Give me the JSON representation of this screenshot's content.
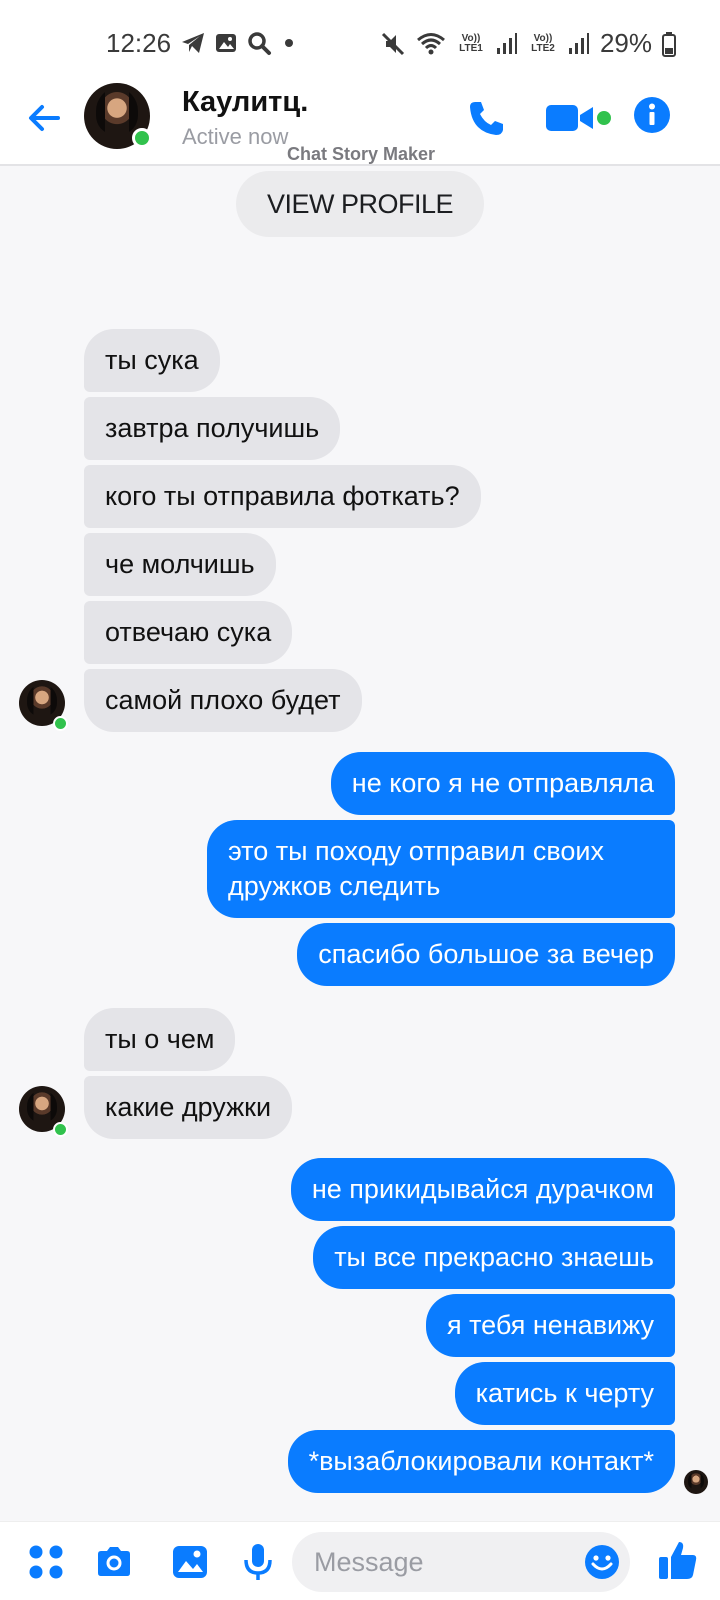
{
  "status_bar": {
    "time": "12:26",
    "battery": "29%",
    "sim1_label": "Vo)) LTE1",
    "sim2_label": "Vo)) LTE2",
    "left_icons": [
      "telegram-icon",
      "gallery-icon",
      "search-icon",
      "dot-icon"
    ],
    "right_icons": [
      "mute-icon",
      "wifi-icon",
      "signal-icon",
      "battery-icon"
    ]
  },
  "header": {
    "contact_name": "Каулитц.",
    "status": "Active now",
    "watermark": "Chat Story Maker",
    "accent_color": "#0a7cff"
  },
  "view_profile_label": "VIEW PROFILE",
  "messages": [
    {
      "from": "them",
      "text": "ты сука"
    },
    {
      "from": "them",
      "text": "завтра получишь"
    },
    {
      "from": "them",
      "text": "кого ты отправила фоткать?"
    },
    {
      "from": "them",
      "text": "че молчишь"
    },
    {
      "from": "them",
      "text": "отвечаю сука"
    },
    {
      "from": "them",
      "text": "самой плохо будет"
    },
    {
      "from": "me",
      "text": "не кого я не отправляла"
    },
    {
      "from": "me",
      "text": "это ты походу отправил своих дружков следить"
    },
    {
      "from": "me",
      "text": "спасибо большое за вечер"
    },
    {
      "from": "them",
      "text": "ты о чем"
    },
    {
      "from": "them",
      "text": "какие дружки"
    },
    {
      "from": "me",
      "text": "не прикидывайся дурачком"
    },
    {
      "from": "me",
      "text": "ты все прекрасно знаешь"
    },
    {
      "from": "me",
      "text": "я тебя ненавижу"
    },
    {
      "from": "me",
      "text": "катись к черту"
    },
    {
      "from": "me",
      "text": "*вызаблокировали контакт*"
    }
  ],
  "composer": {
    "placeholder": "Message",
    "icons": [
      "apps-icon",
      "camera-icon",
      "image-icon",
      "mic-icon",
      "emoji-icon",
      "like-icon"
    ]
  }
}
